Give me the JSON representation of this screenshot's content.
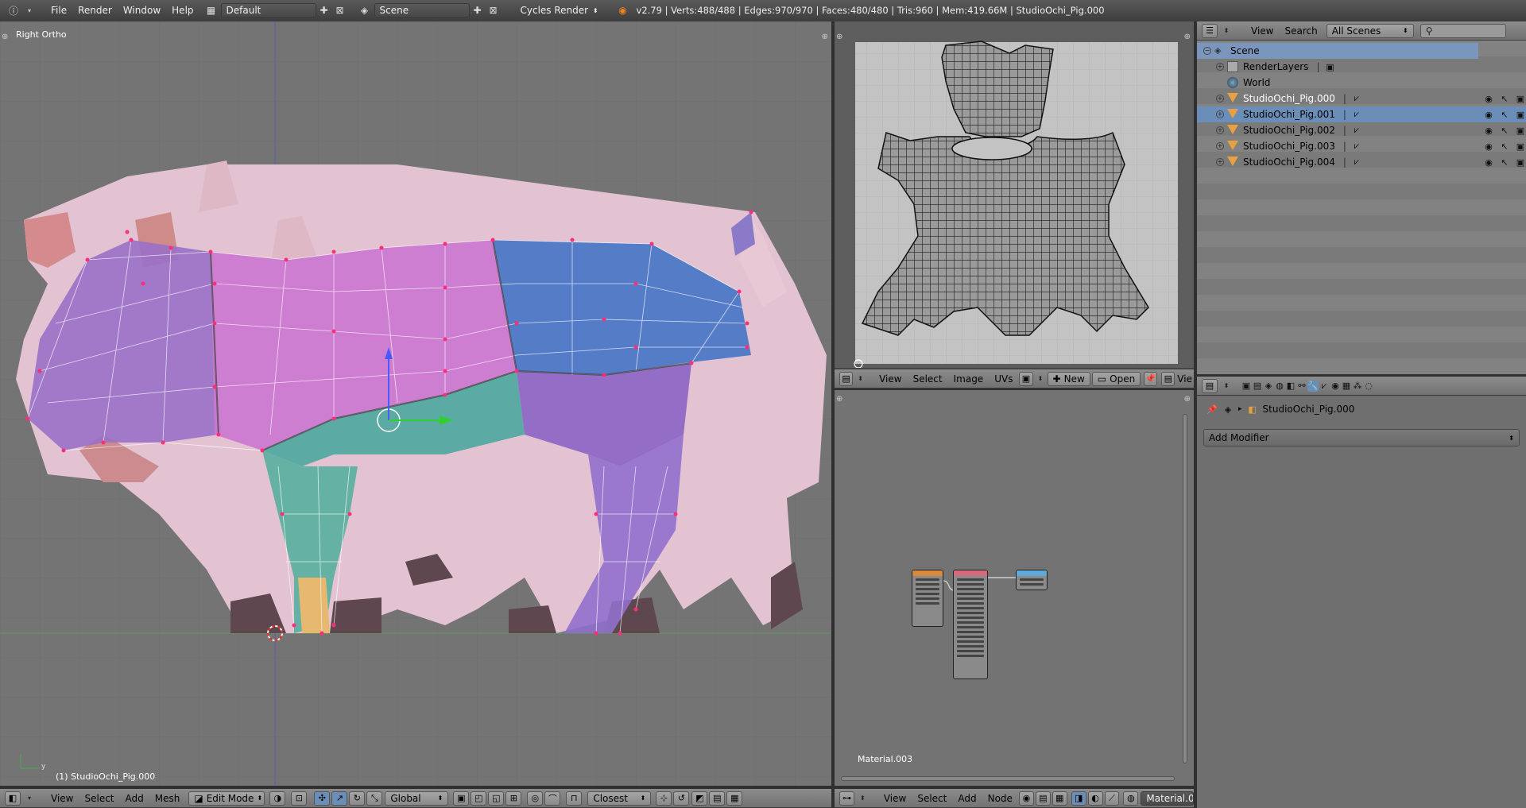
{
  "topbar": {
    "menus": [
      "File",
      "Render",
      "Window",
      "Help"
    ],
    "layout": "Default",
    "scene": "Scene",
    "engine": "Cycles Render",
    "stats": "v2.79 | Verts:488/488 | Edges:970/970 | Faces:480/480 | Tris:960 | Mem:419.66M | StudioOchi_Pig.000"
  },
  "viewport": {
    "view_label": "Right Ortho",
    "object_label": "(1) StudioOchi_Pig.000",
    "header": {
      "menus": [
        "View",
        "Select",
        "Add",
        "Mesh"
      ],
      "mode": "Edit Mode",
      "orientation": "Global",
      "snap": "Closest"
    }
  },
  "uv_editor": {
    "header": {
      "menus": [
        "View",
        "Select",
        "Image",
        "UVs"
      ],
      "new_label": "New",
      "open_label": "Open",
      "view_cut": "Vie"
    }
  },
  "node_editor": {
    "material_label": "Material.003",
    "header": {
      "menus": [
        "View",
        "Select",
        "Add",
        "Node"
      ],
      "material": "Material.00"
    }
  },
  "outliner": {
    "header": {
      "menus": [
        "View",
        "Search"
      ],
      "filter": "All Scenes"
    },
    "rows": [
      {
        "label": "Scene",
        "type": "scene"
      },
      {
        "label": "RenderLayers",
        "type": "renderlayers"
      },
      {
        "label": "World",
        "type": "world"
      },
      {
        "label": "StudioOchi_Pig.000",
        "type": "mesh"
      },
      {
        "label": "StudioOchi_Pig.001",
        "type": "mesh"
      },
      {
        "label": "StudioOchi_Pig.002",
        "type": "mesh"
      },
      {
        "label": "StudioOchi_Pig.003",
        "type": "mesh"
      },
      {
        "label": "StudioOchi_Pig.004",
        "type": "mesh"
      }
    ]
  },
  "properties": {
    "object": "StudioOchi_Pig.000",
    "add_modifier": "Add Modifier"
  },
  "colors": {
    "selection": "#7b96bc",
    "vertex": "#ff2e78",
    "viewport_bg": "#747474"
  }
}
